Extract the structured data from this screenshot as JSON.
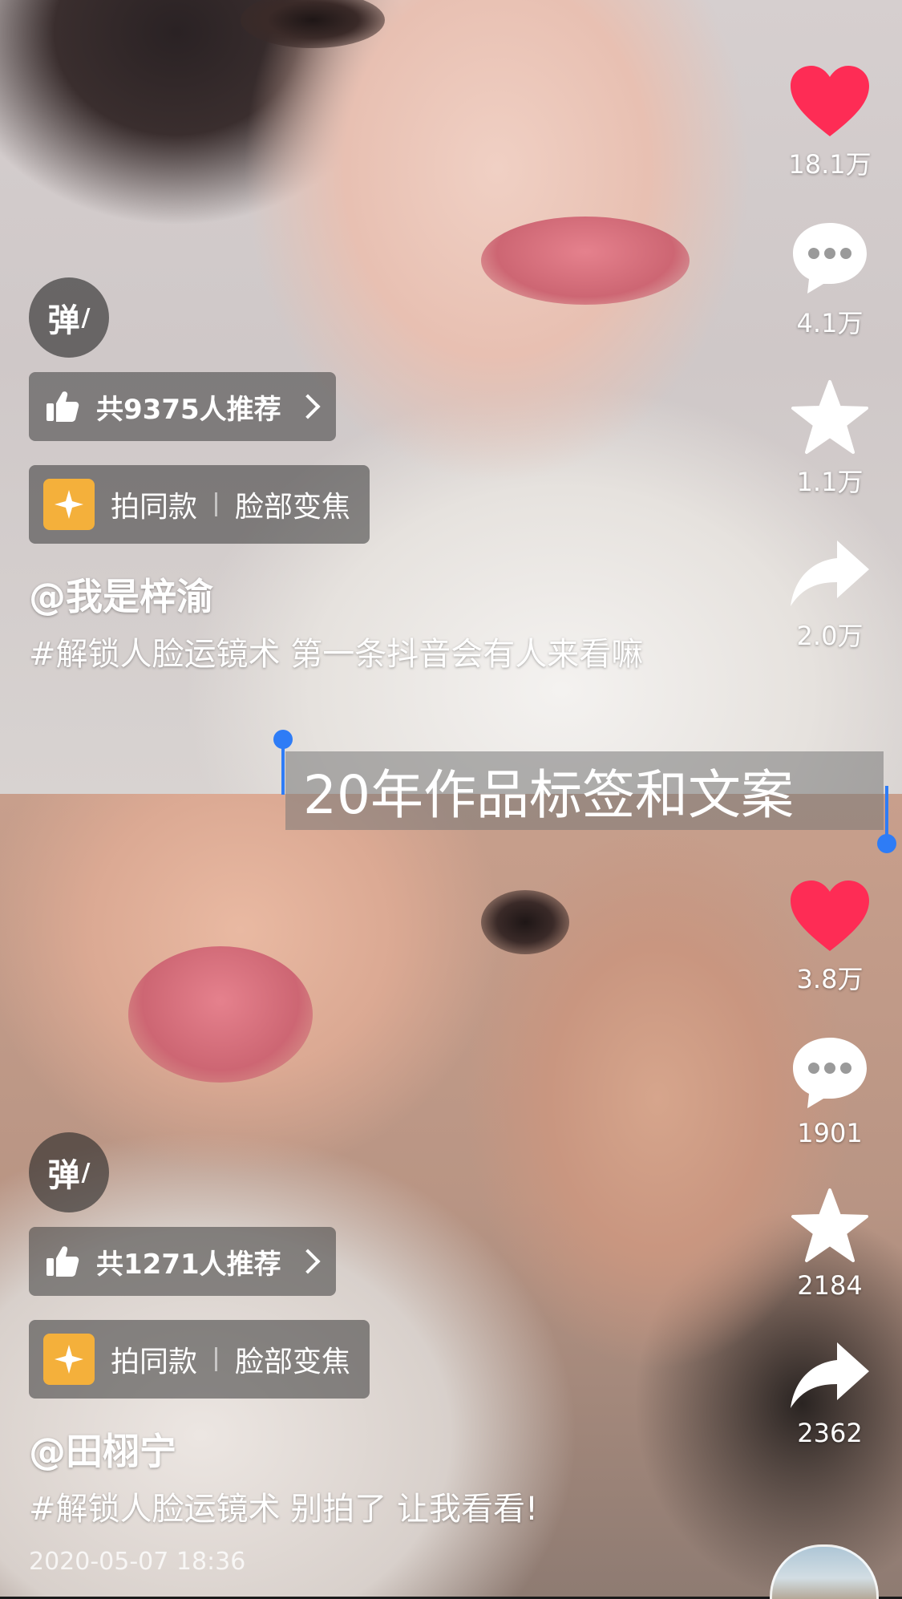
{
  "annotation": {
    "text": "20年作品标签和文案"
  },
  "posts": [
    {
      "danmu_label": "弹",
      "recommend_text": "共9375人推荐",
      "effect": {
        "action": "拍同款",
        "name": "脸部变焦"
      },
      "username": "@我是梓渝",
      "caption": "#解锁人脸运镜术 第一条抖音会有人来看嘛",
      "actions": {
        "likes": "18.1万",
        "comments": "4.1万",
        "favorites": "1.1万",
        "shares": "2.0万"
      }
    },
    {
      "danmu_label": "弹",
      "recommend_text": "共1271人推荐",
      "effect": {
        "action": "拍同款",
        "name": "脸部变焦"
      },
      "username": "@田栩宁",
      "caption": "#解锁人脸运镜术 别拍了 让我看看!",
      "timestamp": "2020-05-07 18:36",
      "actions": {
        "likes": "3.8万",
        "comments": "1901",
        "favorites": "2184",
        "shares": "2362"
      }
    }
  ],
  "colors": {
    "like_heart": "#fe2c55",
    "selection_handle": "#2e7cf6",
    "effect_icon_bg": "#f4b03b"
  },
  "icons": [
    "danmu-icon",
    "thumbs-up-icon",
    "chevron-right-icon",
    "sparkle-icon",
    "heart-icon",
    "comment-icon",
    "star-icon",
    "share-icon"
  ]
}
